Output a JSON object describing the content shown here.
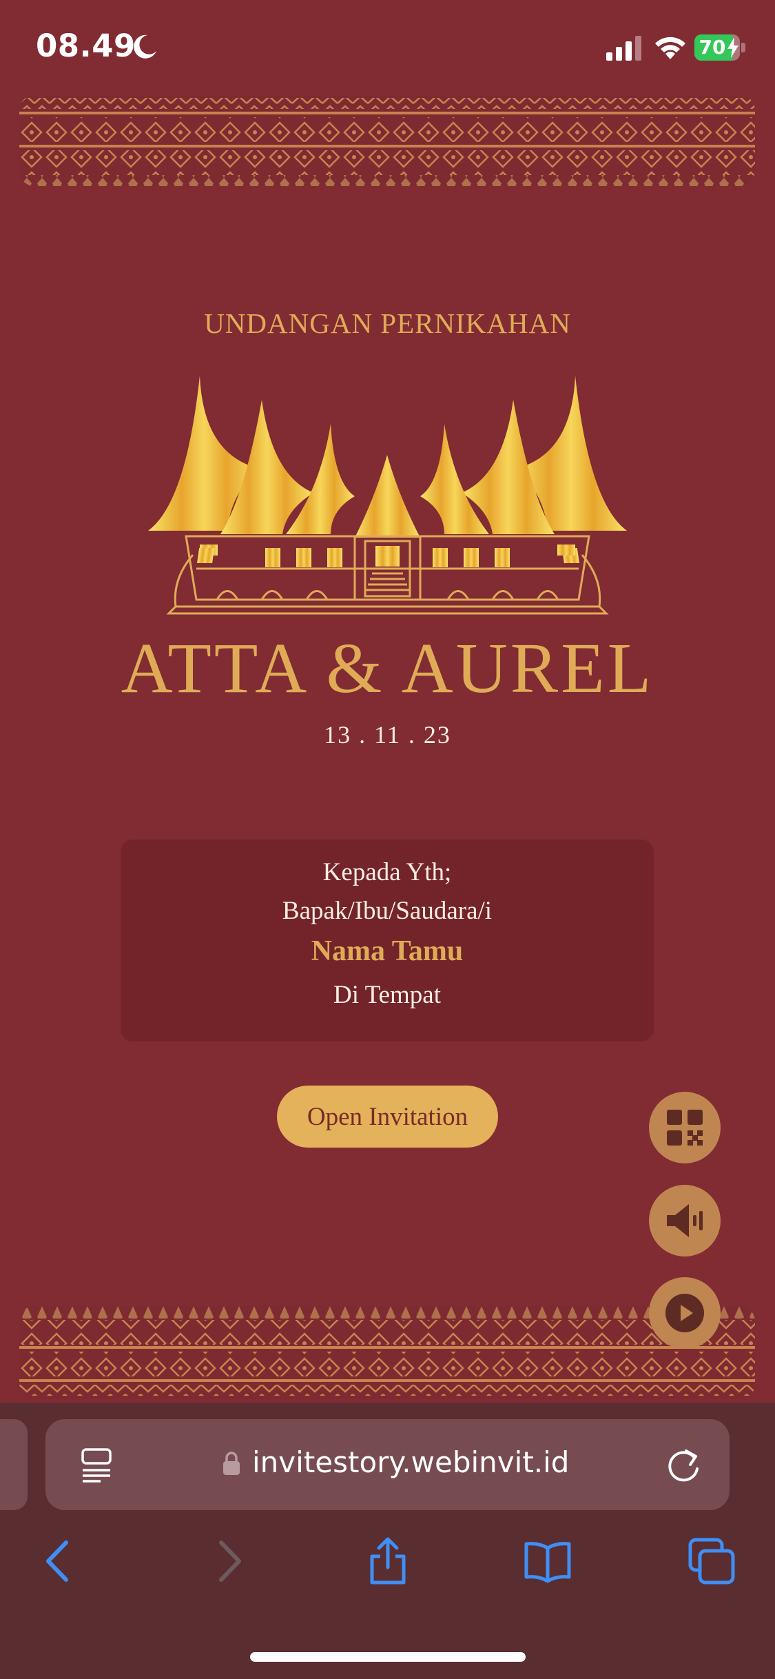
{
  "status_bar": {
    "time": "08.49",
    "battery": "70"
  },
  "colors": {
    "background": "#812b33",
    "gold": "#e0ab57",
    "card": "#73242b",
    "button": "#e3b25a",
    "fab": "#c08651"
  },
  "invitation": {
    "subtitle": "UNDANGAN PERNIKAHAN",
    "couple": "ATTA & AUREL",
    "date": "13 . 11 . 23",
    "greeting": "Kepada Yth;",
    "salutation": "Bapak/Ibu/Saudara/i",
    "guest_name": "Nama Tamu",
    "location": "Di Tempat",
    "open_button": "Open Invitation"
  },
  "floating_buttons": [
    {
      "icon": "qr-code-icon"
    },
    {
      "icon": "speaker-icon"
    },
    {
      "icon": "play-icon"
    }
  ],
  "browser": {
    "url": "invitestory.webinvit.id",
    "toolbar": [
      "back-icon",
      "forward-icon",
      "share-icon",
      "bookmarks-icon",
      "tabs-icon"
    ]
  }
}
